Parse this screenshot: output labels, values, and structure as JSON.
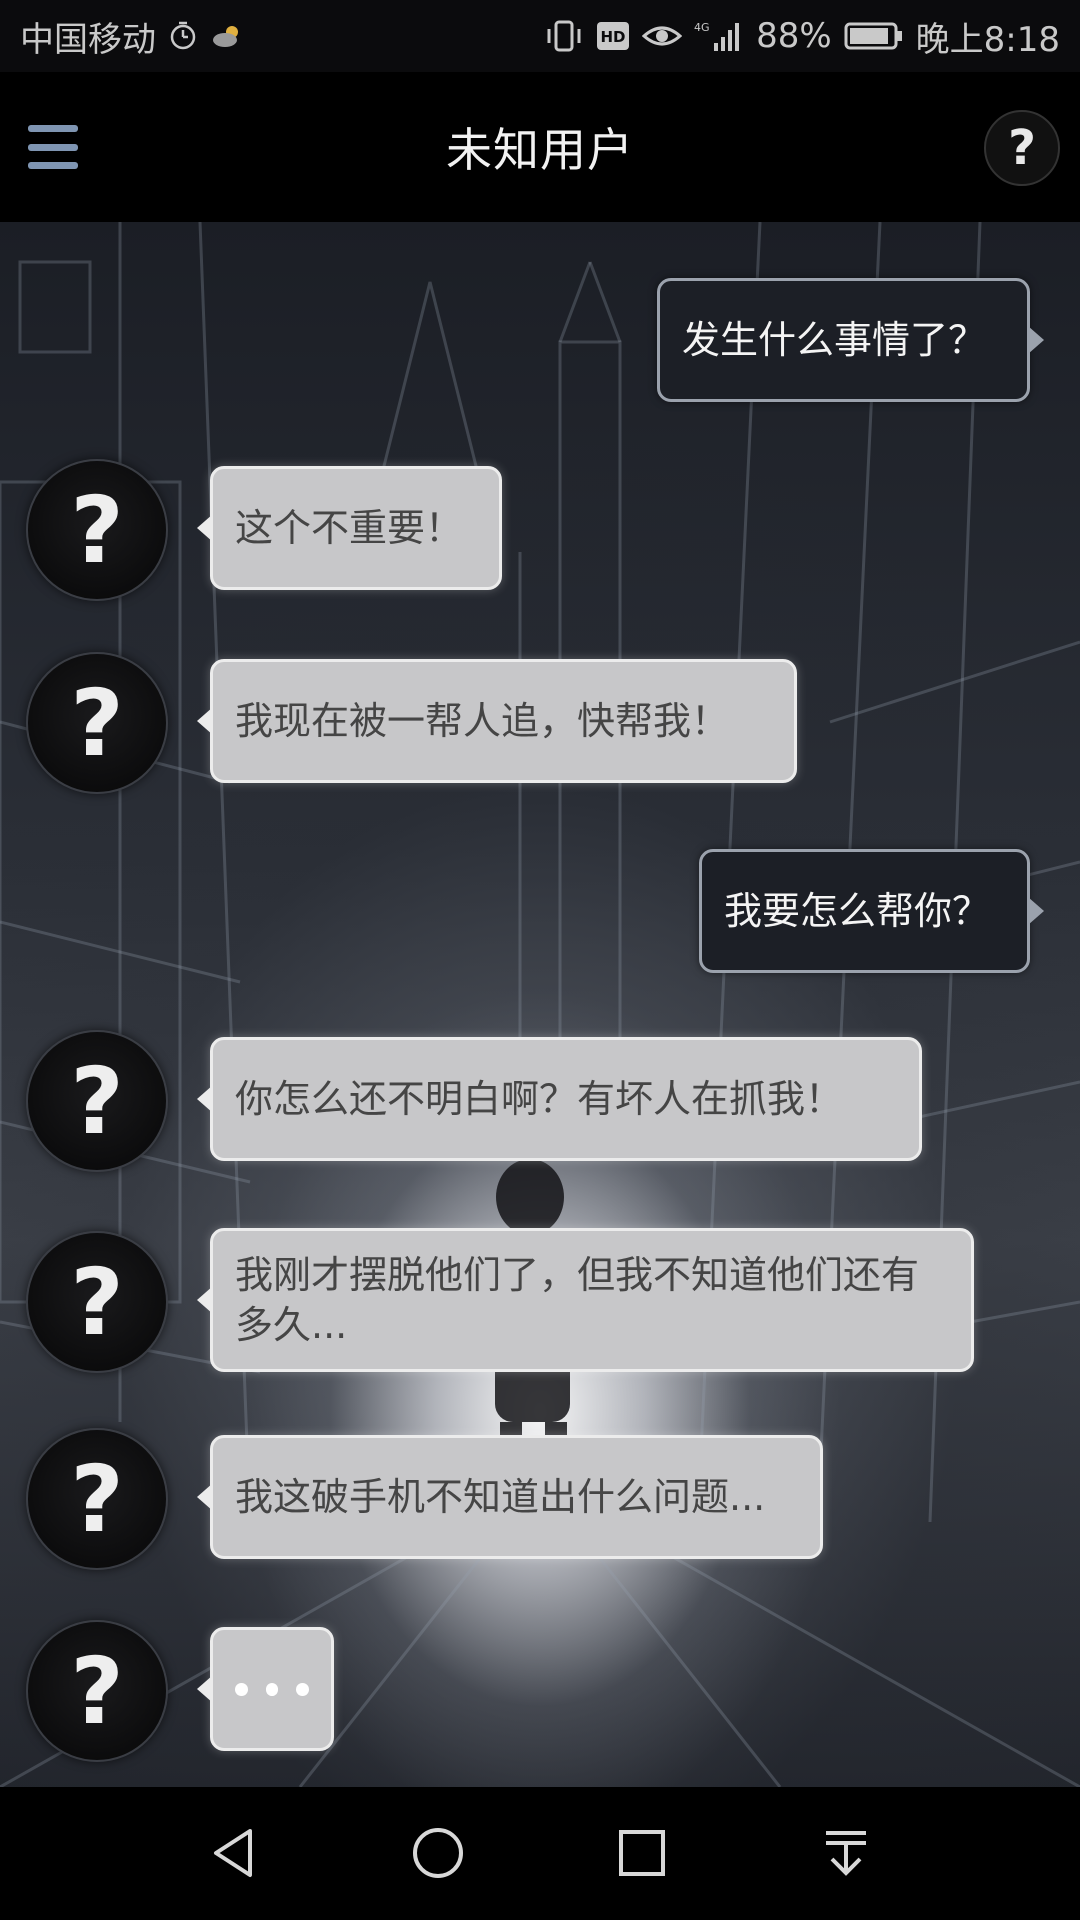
{
  "status_bar": {
    "carrier": "中国移动",
    "network": "4G",
    "battery": "88%",
    "time": "晚上8:18",
    "icons": [
      "alarm-icon",
      "weather-cloud-icon",
      "vibrate-icon",
      "hd-icon",
      "eye-icon",
      "signal-icon",
      "battery-icon"
    ]
  },
  "header": {
    "title": "未知用户",
    "menu_icon": "hamburger-menu-icon",
    "help_label": "?"
  },
  "avatar_glyph": "?",
  "messages": [
    {
      "side": "out",
      "text": "发生什么事情了？"
    },
    {
      "side": "in",
      "text": "这个不重要！"
    },
    {
      "side": "in",
      "text": "我现在被一帮人追，快帮我！"
    },
    {
      "side": "out",
      "text": "我要怎么帮你？"
    },
    {
      "side": "in",
      "text": "你怎么还不明白啊？有坏人在抓我！"
    },
    {
      "side": "in",
      "text": "我刚才摆脱他们了，但我不知道他们还有多久..."
    },
    {
      "side": "in",
      "text": "我这破手机不知道出什么问题..."
    },
    {
      "side": "in",
      "typing": true
    }
  ],
  "nav_bar": {
    "icons": [
      "back-icon",
      "home-icon",
      "recents-icon",
      "notification-drawer-icon"
    ]
  },
  "colors": {
    "incoming_bubble": "#c7c7c9",
    "outgoing_bubble": "#1c1f26",
    "menu_icon": "#7f95b2"
  }
}
